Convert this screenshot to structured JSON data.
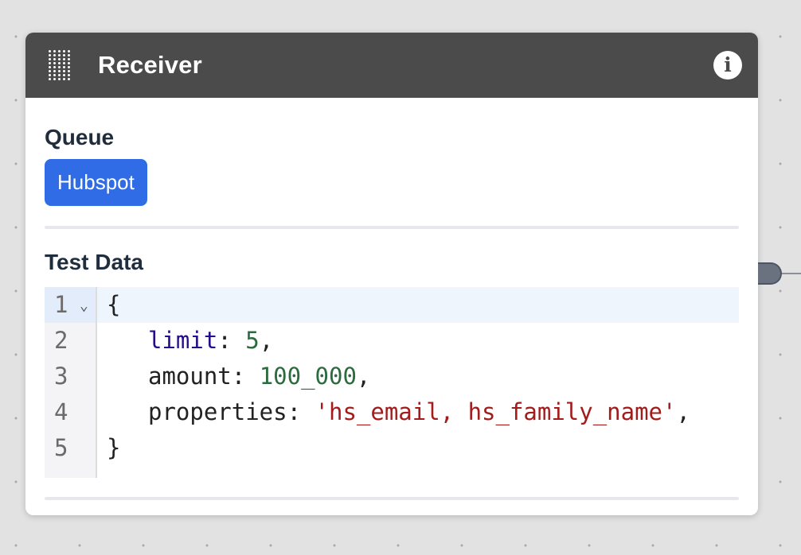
{
  "node": {
    "title": "Receiver",
    "info_icon": "info-icon",
    "drag_icon": "drag-handle-icon"
  },
  "queue": {
    "label": "Queue",
    "value": "Hubspot"
  },
  "test_data": {
    "label": "Test Data",
    "line_numbers": [
      "1",
      "2",
      "3",
      "4",
      "5"
    ],
    "lines": [
      {
        "open": "{"
      },
      {
        "key": "limit",
        "sep": ": ",
        "value": "5",
        "trail": ","
      },
      {
        "key": "amount",
        "sep": ": ",
        "value": "100_000",
        "trail": ","
      },
      {
        "key": "properties",
        "sep": ": ",
        "value": "'hs_email, hs_family_name'",
        "trail": ","
      },
      {
        "close": "}"
      }
    ]
  },
  "colors": {
    "header_bg": "#4b4b4b",
    "tag_bg": "#2f6ce6",
    "key": "#240c8c",
    "number": "#2c6a3f",
    "string": "#a31b1b"
  }
}
